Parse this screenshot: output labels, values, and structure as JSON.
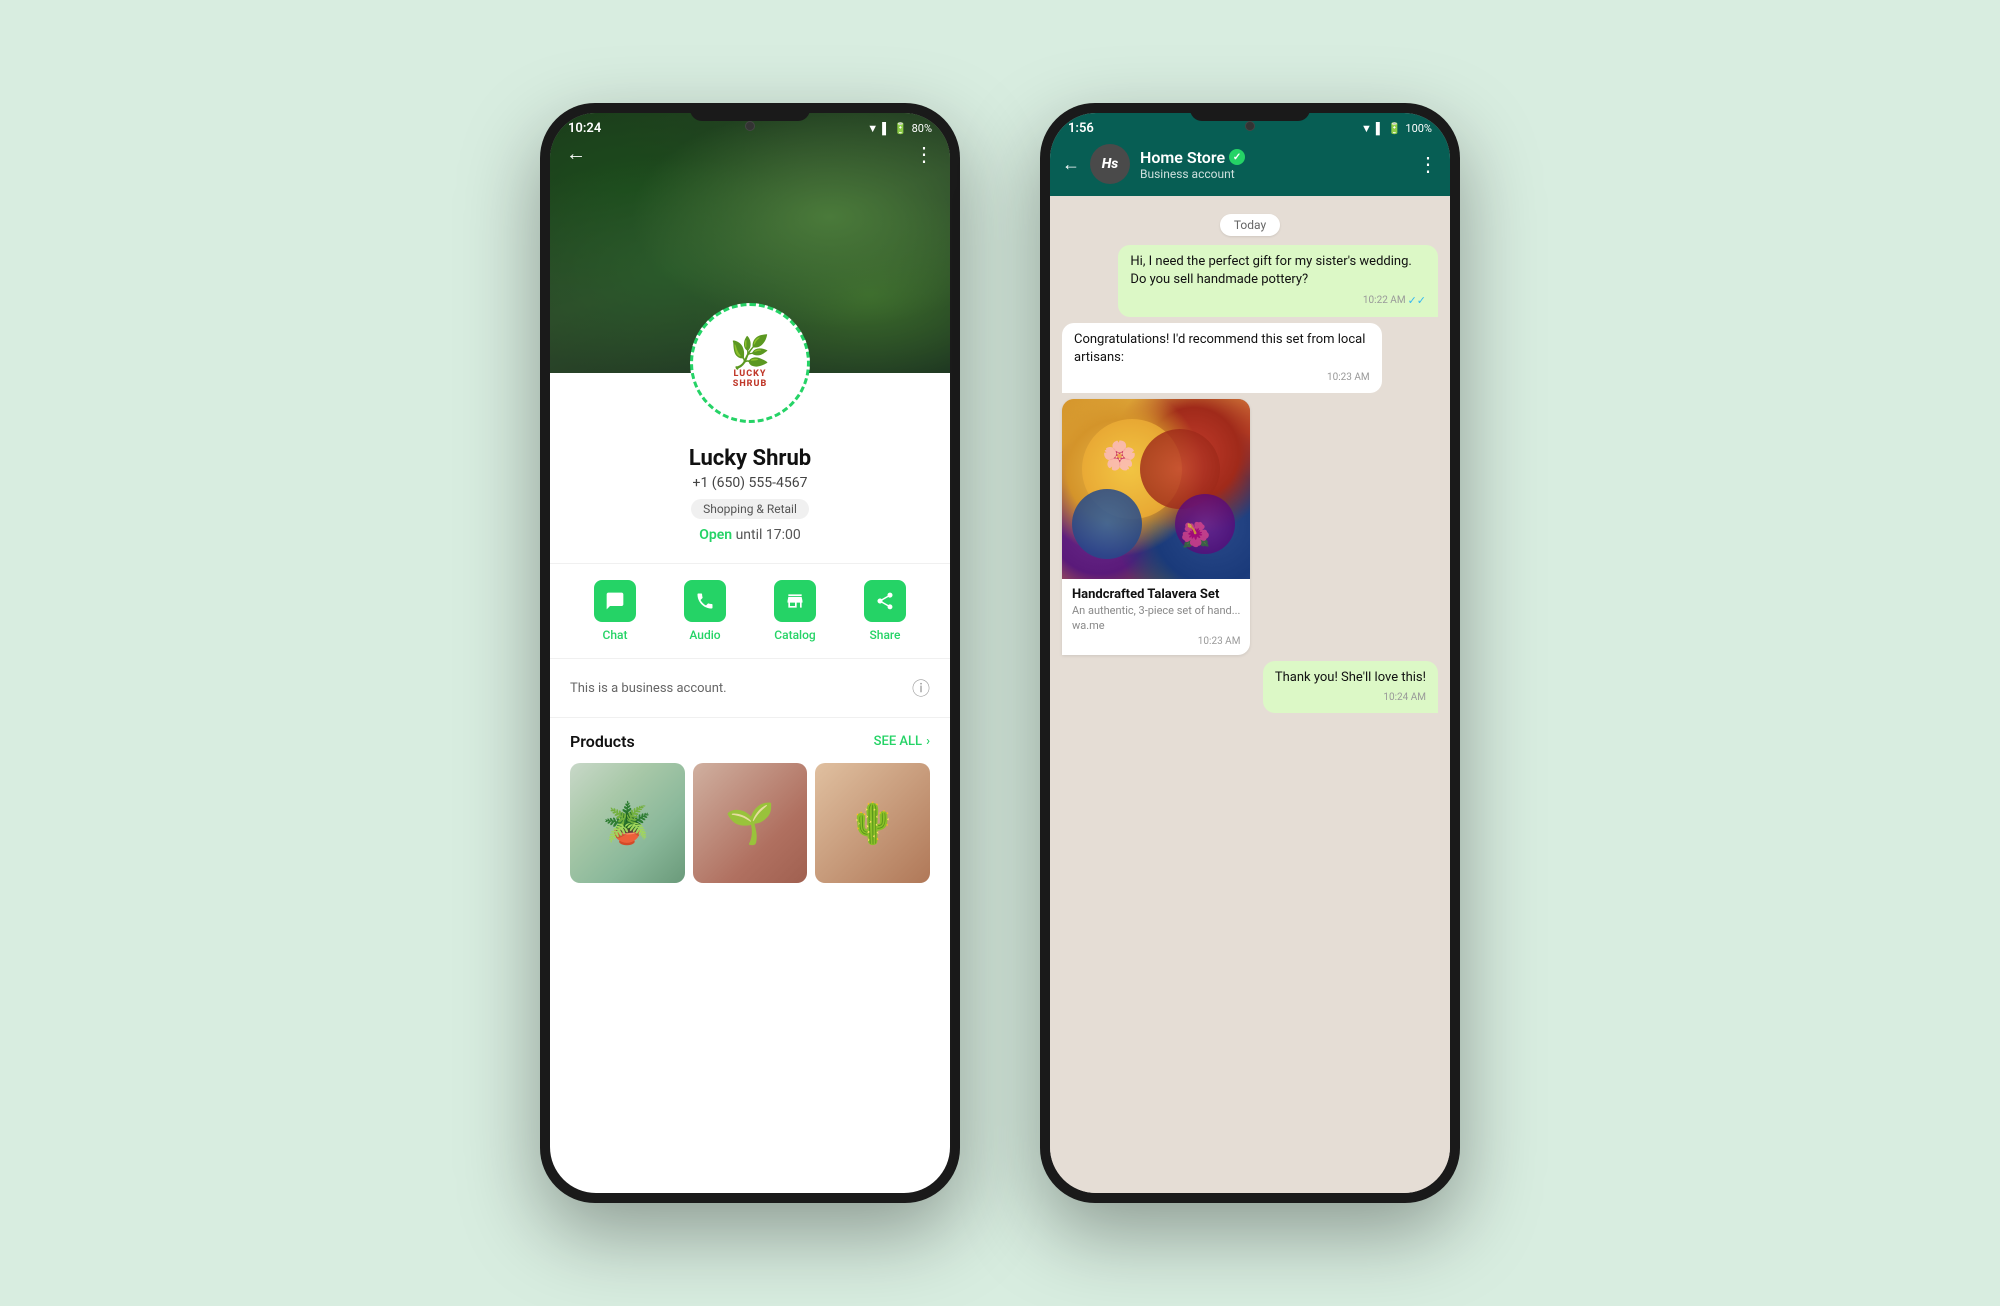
{
  "background": "#d8ede0",
  "phone1": {
    "status_time": "10:24",
    "battery": "80%",
    "business_name": "Lucky Shrub",
    "phone_number": "+1 (650) 555-4567",
    "category": "Shopping & Retail",
    "hours": "Open until 17:00",
    "open_label": "Open",
    "hours_suffix": " until 17:00",
    "actions": [
      {
        "label": "Chat",
        "icon": "💬"
      },
      {
        "label": "Audio",
        "icon": "📞"
      },
      {
        "label": "Catalog",
        "icon": "🏪"
      },
      {
        "label": "Share",
        "icon": "↪"
      }
    ],
    "business_info": "This is a business account.",
    "products_label": "Products",
    "see_all": "SEE ALL"
  },
  "phone2": {
    "status_time": "1:56",
    "battery": "100%",
    "contact_name": "Home Store",
    "contact_sub": "Business account",
    "date_label": "Today",
    "messages": [
      {
        "type": "sent",
        "text": "Hi, I need the perfect gift for my sister's wedding. Do you sell handmade pottery?",
        "time": "10:22 AM",
        "ticks": "✓✓"
      },
      {
        "type": "received",
        "text": "Congratulations! I'd recommend this set from local artisans:",
        "time": "10:23 AM"
      },
      {
        "type": "product-card",
        "title": "Handcrafted Talavera Set",
        "description": "An authentic, 3-piece set of hand...",
        "link": "wa.me",
        "time": "10:23 AM"
      },
      {
        "type": "sent",
        "text": "Thank you! She'll love this!",
        "time": "10:24 AM"
      }
    ]
  }
}
